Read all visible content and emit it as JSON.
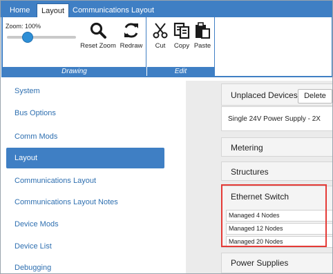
{
  "tabs": [
    {
      "label": "Home"
    },
    {
      "label": "Layout"
    },
    {
      "label": "Communications Layout"
    }
  ],
  "ribbon": {
    "zoom_label": "Zoom: 100%",
    "zoom_level_percent": 100,
    "drawing": {
      "group_label": "Drawing",
      "reset_zoom": "Reset Zoom",
      "redraw": "Redraw"
    },
    "edit": {
      "group_label": "Edit",
      "cut": "Cut",
      "copy": "Copy",
      "paste": "Paste"
    }
  },
  "nav": {
    "items": [
      {
        "label": "System"
      },
      {
        "label": "Bus Options"
      },
      {
        "label": "Comm Mods"
      },
      {
        "label": "Layout",
        "active": true
      },
      {
        "label": "Communications Layout"
      },
      {
        "label": "Communications Layout Notes"
      },
      {
        "label": "Device Mods"
      },
      {
        "label": "Device List"
      },
      {
        "label": "Debugging"
      }
    ]
  },
  "panel": {
    "unplaced_title": "Unplaced Devices",
    "delete_label": "Delete",
    "unplaced_items": [
      "Single 24V Power Supply - 2X"
    ],
    "metering": "Metering",
    "structures": "Structures",
    "ethernet_switch": {
      "title": "Ethernet Switch",
      "items": [
        "Managed 4 Nodes",
        "Managed 12 Nodes",
        "Managed 20 Nodes"
      ]
    },
    "power_supplies": "Power Supplies"
  },
  "colors": {
    "accent": "#3f7fc4",
    "link": "#2e6fb0",
    "highlight": "#e53935",
    "slider_thumb": "#2f8fd6"
  },
  "icons": [
    "search-icon",
    "redraw-icon",
    "scissors-icon",
    "copy-icon",
    "paste-icon"
  ]
}
